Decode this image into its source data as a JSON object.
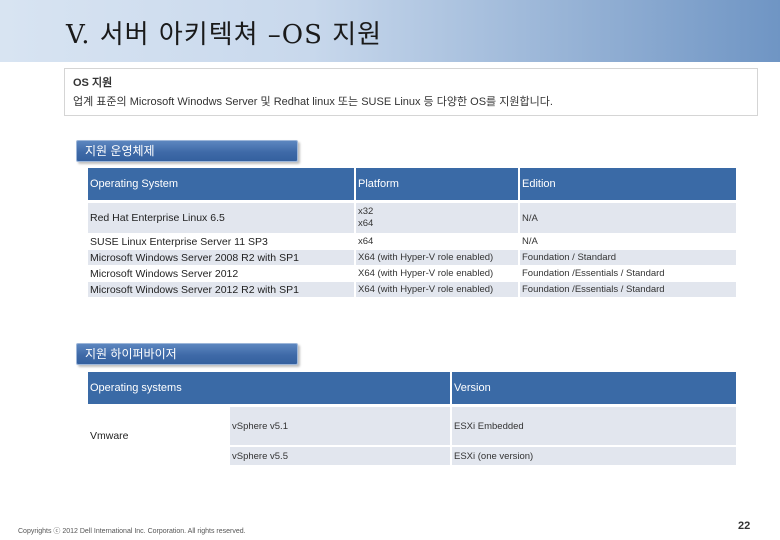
{
  "slide": {
    "title": "V. 서버 아키텍쳐 –OS 지원",
    "intro_heading": "OS 지원",
    "intro_text": "업계 표준의 Microsoft Winodws Server 및 Redhat linux 또는 SUSE Linux 등 다양한 OS를 지원합니다.",
    "section1_label": "지원 운영체제",
    "section2_label": "지원 하이퍼바이저",
    "footer": "Copyrights ⓒ 2012 Dell International Inc. Corporation. All rights reserved.",
    "page_number": "22"
  },
  "os_table": {
    "headers": [
      "Operating System",
      "Platform",
      "Edition"
    ],
    "rows": [
      {
        "os": "Red Hat Enterprise Linux 6.5",
        "platform_line1": "x32",
        "platform_line2": "x64",
        "edition": "N/A"
      },
      {
        "os": "SUSE Linux Enterprise Server 11 SP3",
        "platform": "x64",
        "edition": "N/A"
      },
      {
        "os": "Microsoft Windows Server 2008 R2 with SP1",
        "platform": "X64 (with Hyper-V role enabled)",
        "edition": "Foundation / Standard"
      },
      {
        "os": "Microsoft Windows Server 2012",
        "platform": "X64 (with Hyper-V role enabled)",
        "edition": "Foundation /Essentials / Standard"
      },
      {
        "os": "Microsoft Windows Server 2012 R2 with SP1",
        "platform": "X64 (with Hyper-V role enabled)",
        "edition": "Foundation /Essentials / Standard"
      }
    ]
  },
  "hv_table": {
    "headers": [
      "Operating systems",
      "Version"
    ],
    "vendor": "Vmware",
    "rows": [
      {
        "product": "vSphere v5.1",
        "version": "ESXi Embedded"
      },
      {
        "product": "vSphere v5.5",
        "version": "ESXi (one version)"
      }
    ]
  }
}
